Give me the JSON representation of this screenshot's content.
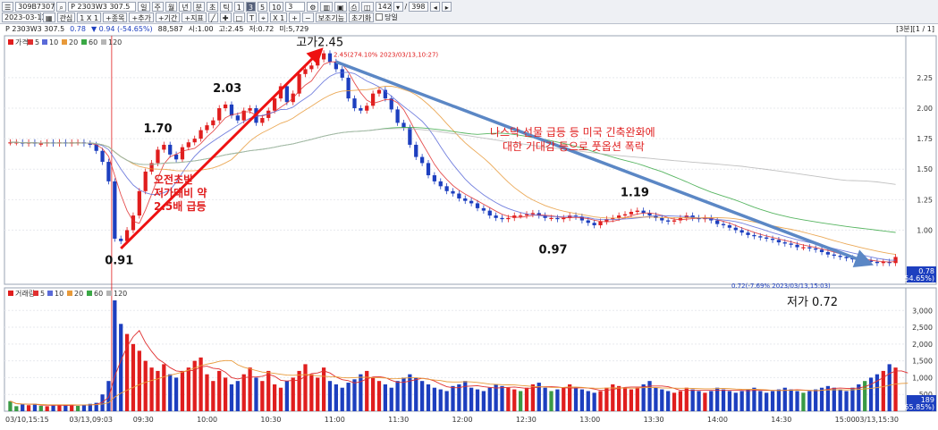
{
  "toolbar": {
    "code": "309B7307",
    "name_field": "P 2303W3 307.5",
    "date": "2023-03-13",
    "interest_label": "관심",
    "ratio": "1 X 1",
    "period_buttons": [
      "일",
      "주",
      "월",
      "년",
      "분",
      "초",
      "틱"
    ],
    "minute_buttons": [
      "1",
      "3",
      "5",
      "10",
      "3"
    ],
    "count_value": "142",
    "total_value": "398",
    "row2_labels": [
      "+종목",
      "+추가",
      "+기간",
      "+지표"
    ],
    "zoom": "X 1",
    "aux_button": "보조기능",
    "reset_button": "초기화",
    "same_day_label": "당일"
  },
  "infobar": {
    "name": "P 2303W3 307.5",
    "price": "0.78",
    "change": "▼ 0.94 (-54.65%)",
    "volume": "88,587",
    "high": "시:1.00",
    "low": "고:2.45",
    "close": "저:0.72",
    "last": "미:5,729",
    "right": "[3분][1 / 1]"
  },
  "colors": {
    "up": "#e01e1e",
    "down": "#1d3fbf",
    "ma5": "#e03030",
    "ma10": "#5a6ad8",
    "ma20": "#e89a3a",
    "ma60": "#3aa845",
    "ma120": "#b5b5b5",
    "trend_up": "#ee1111",
    "trend_down": "#5b87c5",
    "annotation": "#e01e1e",
    "vol_up": "#e01e1e",
    "vol_down": "#1d3fbf",
    "vol_flat": "#3a9a45"
  },
  "price_legend": [
    {
      "label": "가격",
      "color": "#e01e1e"
    },
    {
      "label": "5",
      "color": "#e03030"
    },
    {
      "label": "10",
      "color": "#5a6ad8"
    },
    {
      "label": "20",
      "color": "#e89a3a"
    },
    {
      "label": "60",
      "color": "#3aa845"
    },
    {
      "label": "120",
      "color": "#b5b5b5"
    }
  ],
  "volume_legend": [
    {
      "label": "거래량",
      "color": "#e01e1e"
    },
    {
      "label": "5",
      "color": "#e03030"
    },
    {
      "label": "10",
      "color": "#5a6ad8"
    },
    {
      "label": "20",
      "color": "#e89a3a"
    },
    {
      "label": "60",
      "color": "#3aa845"
    },
    {
      "label": "120",
      "color": "#b5b5b5"
    }
  ],
  "price_axis_labels": [
    "2.25",
    "2.00",
    "1.75",
    "1.50",
    "1.25",
    "1.00"
  ],
  "volume_axis_labels": [
    "3,000",
    "2,500",
    "2,000",
    "1,500",
    "1,000",
    "500"
  ],
  "time_labels": [
    "03/10,15:15",
    "03/13,09:03",
    "09:30",
    "10:00",
    "10:30",
    "11:00",
    "11:30",
    "12:00",
    "12:30",
    "13:00",
    "13:30",
    "14:00",
    "14:30",
    "15:00",
    "03/13,15:30"
  ],
  "current_price_box": {
    "price": "0.78",
    "change": "(-54.65%)"
  },
  "volume_box": {
    "value": "189",
    "change": "( 65.85%)"
  },
  "annotations": {
    "low_start": "0.91",
    "p170": "1.70",
    "p203": "2.03",
    "high": "고가2.45",
    "high_detail": "2.45(274.10% 2023/03/13,10:27)",
    "morning_note": [
      "오전초반",
      "저가대비 약",
      "2.5배 급등"
    ],
    "p119": "1.19",
    "p097": "0.97",
    "nasdaq_note": [
      "나스닥 선물 급등 등 미국 긴축완화에",
      "대한 기대감 등으로 풋옵션 폭락"
    ],
    "low_detail": "0.72(-7.69% 2023/03/13,15:03)",
    "low_end": "저가 0.72"
  },
  "chart_data": {
    "type": "candlestick",
    "title": "P 2303W3 307.5",
    "interval": "3분",
    "price_ylim": [
      0.72,
      2.45
    ],
    "volume_ylim": [
      0,
      3300
    ],
    "price_series": {
      "name": "가격",
      "closes": [
        1.72,
        1.72,
        1.71,
        1.72,
        1.71,
        1.71,
        1.72,
        1.71,
        1.72,
        1.71,
        1.72,
        1.72,
        1.71,
        1.7,
        1.65,
        1.56,
        1.4,
        0.93,
        0.91,
        1.0,
        1.12,
        1.32,
        1.48,
        1.55,
        1.66,
        1.7,
        1.62,
        1.58,
        1.68,
        1.72,
        1.75,
        1.82,
        1.86,
        1.9,
        2.0,
        2.03,
        1.94,
        1.9,
        1.98,
        2.0,
        1.88,
        1.92,
        1.98,
        2.08,
        2.18,
        2.05,
        2.12,
        2.28,
        2.32,
        2.35,
        2.4,
        2.45,
        2.38,
        2.32,
        2.25,
        2.08,
        2.0,
        1.98,
        2.02,
        2.12,
        2.15,
        2.08,
        1.99,
        1.88,
        1.84,
        1.7,
        1.6,
        1.55,
        1.45,
        1.4,
        1.36,
        1.32,
        1.3,
        1.26,
        1.24,
        1.22,
        1.18,
        1.16,
        1.12,
        1.1,
        1.09,
        1.1,
        1.12,
        1.12,
        1.13,
        1.14,
        1.12,
        1.1,
        1.1,
        1.09,
        1.1,
        1.12,
        1.11,
        1.08,
        1.06,
        1.04,
        1.07,
        1.09,
        1.1,
        1.12,
        1.13,
        1.15,
        1.16,
        1.14,
        1.12,
        1.1,
        1.08,
        1.07,
        1.08,
        1.1,
        1.12,
        1.1,
        1.09,
        1.1,
        1.08,
        1.05,
        1.04,
        1.02,
        1.0,
        0.98,
        0.96,
        0.95,
        0.94,
        0.93,
        0.92,
        0.9,
        0.89,
        0.88,
        0.86,
        0.86,
        0.85,
        0.84,
        0.82,
        0.8,
        0.79,
        0.78,
        0.77,
        0.76,
        0.75,
        0.75,
        0.74,
        0.73,
        0.74,
        0.73,
        0.78
      ]
    },
    "moving_averages": [
      {
        "name": "5",
        "period": 5
      },
      {
        "name": "10",
        "period": 10
      },
      {
        "name": "20",
        "period": 20
      },
      {
        "name": "60",
        "period": 60
      },
      {
        "name": "120",
        "period": 120
      }
    ],
    "key_points": [
      {
        "label": "0.91",
        "value": 0.91
      },
      {
        "label": "1.70",
        "value": 1.7
      },
      {
        "label": "2.03",
        "value": 2.03
      },
      {
        "label": "고가2.45",
        "value": 2.45
      },
      {
        "label": "1.19",
        "value": 1.19
      },
      {
        "label": "0.97",
        "value": 0.97
      },
      {
        "label": "저가 0.72",
        "value": 0.72
      }
    ],
    "volume_series": {
      "name": "거래량",
      "values": [
        300,
        150,
        200,
        180,
        220,
        160,
        150,
        170,
        200,
        180,
        190,
        160,
        200,
        220,
        250,
        500,
        900,
        3300,
        2600,
        2300,
        2000,
        1800,
        1500,
        1300,
        1200,
        1400,
        1100,
        1000,
        1200,
        1300,
        1500,
        1600,
        1100,
        900,
        1200,
        1000,
        800,
        900,
        1100,
        1300,
        1000,
        900,
        1200,
        800,
        700,
        900,
        1000,
        1200,
        1400,
        1100,
        1000,
        1300,
        900,
        800,
        700,
        850,
        950,
        1100,
        1200,
        1000,
        900,
        800,
        700,
        900,
        1000,
        1100,
        1000,
        900,
        800,
        700,
        650,
        600,
        750,
        800,
        900,
        700,
        650,
        600,
        700,
        800,
        750,
        700,
        650,
        600,
        700,
        800,
        850,
        700,
        600,
        650,
        700,
        800,
        700,
        650,
        600,
        550,
        600,
        700,
        800,
        750,
        700,
        650,
        700,
        800,
        900,
        700,
        650,
        600,
        550,
        600,
        700,
        650,
        600,
        550,
        600,
        700,
        650,
        600,
        550,
        600,
        650,
        700,
        600,
        550,
        600,
        650,
        700,
        650,
        600,
        550,
        600,
        650,
        700,
        750,
        700,
        650,
        600,
        700,
        800,
        900,
        1000,
        1100,
        1200,
        1400,
        1300,
        1000,
        800
      ]
    }
  }
}
